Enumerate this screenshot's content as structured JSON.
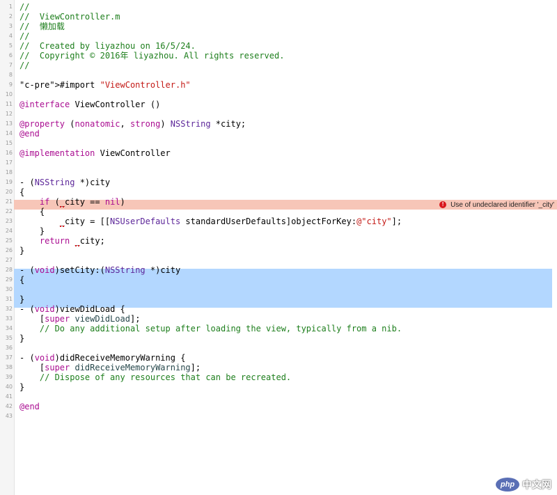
{
  "code_lines": [
    {
      "n": "1",
      "text": "//"
    },
    {
      "n": "2",
      "text": "//  ViewController.m"
    },
    {
      "n": "3",
      "text": "//  懒加载"
    },
    {
      "n": "4",
      "text": "//"
    },
    {
      "n": "5",
      "text": "//  Created by liyazhou on 16/5/24."
    },
    {
      "n": "6",
      "text": "//  Copyright © 2016年 liyazhou. All rights reserved."
    },
    {
      "n": "7",
      "text": "//"
    },
    {
      "n": "8",
      "text": ""
    },
    {
      "n": "9",
      "text": "#import \"ViewController.h\""
    },
    {
      "n": "10",
      "text": ""
    },
    {
      "n": "11",
      "text": "@interface ViewController ()"
    },
    {
      "n": "12",
      "text": ""
    },
    {
      "n": "13",
      "text": "@property (nonatomic, strong) NSString *city;"
    },
    {
      "n": "14",
      "text": "@end"
    },
    {
      "n": "15",
      "text": ""
    },
    {
      "n": "16",
      "text": "@implementation ViewController"
    },
    {
      "n": "17",
      "text": ""
    },
    {
      "n": "18",
      "text": ""
    },
    {
      "n": "19",
      "text": "- (NSString *)city"
    },
    {
      "n": "20",
      "text": "{"
    },
    {
      "n": "21",
      "text": "    if (_city == nil)"
    },
    {
      "n": "22",
      "text": "    {"
    },
    {
      "n": "23",
      "text": "        _city = [[NSUserDefaults standardUserDefaults]objectForKey:@\"city\"];"
    },
    {
      "n": "24",
      "text": "    }"
    },
    {
      "n": "25",
      "text": "    return _city;"
    },
    {
      "n": "26",
      "text": "}"
    },
    {
      "n": "27",
      "text": ""
    },
    {
      "n": "28",
      "text": "- (void)setCity:(NSString *)city"
    },
    {
      "n": "29",
      "text": "{"
    },
    {
      "n": "30",
      "text": ""
    },
    {
      "n": "31",
      "text": "}"
    },
    {
      "n": "32",
      "text": "- (void)viewDidLoad {"
    },
    {
      "n": "33",
      "text": "    [super viewDidLoad];"
    },
    {
      "n": "34",
      "text": "    // Do any additional setup after loading the view, typically from a nib."
    },
    {
      "n": "35",
      "text": "}"
    },
    {
      "n": "36",
      "text": ""
    },
    {
      "n": "37",
      "text": "- (void)didReceiveMemoryWarning {"
    },
    {
      "n": "38",
      "text": "    [super didReceiveMemoryWarning];"
    },
    {
      "n": "39",
      "text": "    // Dispose of any resources that can be recreated."
    },
    {
      "n": "40",
      "text": "}"
    },
    {
      "n": "41",
      "text": ""
    },
    {
      "n": "42",
      "text": "@end"
    },
    {
      "n": "43",
      "text": ""
    }
  ],
  "error": {
    "line": "21",
    "icon": "error-icon",
    "message": "Use of undeclared identifier '_city'"
  },
  "selection": {
    "from_line": "28",
    "to_line": "31"
  },
  "watermark": {
    "logo": "php",
    "text": "中文网"
  },
  "colors": {
    "comment": "#1d7e1c",
    "keyword": "#aa0d91",
    "string": "#c41a16",
    "error_line": "#f7c6b8",
    "selection": "#b3d7ff"
  }
}
